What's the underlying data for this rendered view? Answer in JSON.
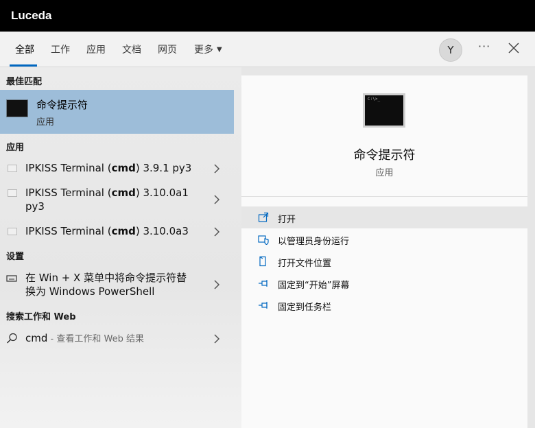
{
  "window": {
    "title": "Luceda"
  },
  "tabs": [
    {
      "label": "全部",
      "active": true
    },
    {
      "label": "工作"
    },
    {
      "label": "应用"
    },
    {
      "label": "文档"
    },
    {
      "label": "网页"
    },
    {
      "label": "更多"
    }
  ],
  "header": {
    "avatar_letter": "Y",
    "more_label": "···"
  },
  "left": {
    "best_match_heading": "最佳匹配",
    "best_match": {
      "title": "命令提示符",
      "subtitle": "应用"
    },
    "apps_heading": "应用",
    "apps": [
      {
        "pre": "IPKISS Terminal (",
        "bold": "cmd",
        "post": ") 3.9.1 py3"
      },
      {
        "pre": "IPKISS Terminal (",
        "bold": "cmd",
        "post": ") 3.10.0a1",
        "line2": "py3"
      },
      {
        "pre": "IPKISS Terminal (",
        "bold": "cmd",
        "post": ") 3.10.0a3"
      }
    ],
    "settings_heading": "设置",
    "settings": [
      {
        "line1": "在 Win + X 菜单中将命令提示符替",
        "line2": "换为 Windows PowerShell"
      }
    ],
    "web_heading": "搜索工作和 Web",
    "web": {
      "query": "cmd",
      "suffix": " - 查看工作和 Web 结果"
    }
  },
  "right": {
    "title": "命令提示符",
    "subtitle": "应用",
    "actions": [
      {
        "label": "打开",
        "icon": "open-icon"
      },
      {
        "label": "以管理员身份运行",
        "icon": "shield-icon"
      },
      {
        "label": "打开文件位置",
        "icon": "file-location-icon"
      },
      {
        "label": "固定到“开始”屏幕",
        "icon": "pin-icon"
      },
      {
        "label": "固定到任务栏",
        "icon": "pin-icon"
      }
    ]
  },
  "colors": {
    "accent": "#0067c0",
    "selected": "#9dbdd9",
    "titlebar": "#000000"
  }
}
